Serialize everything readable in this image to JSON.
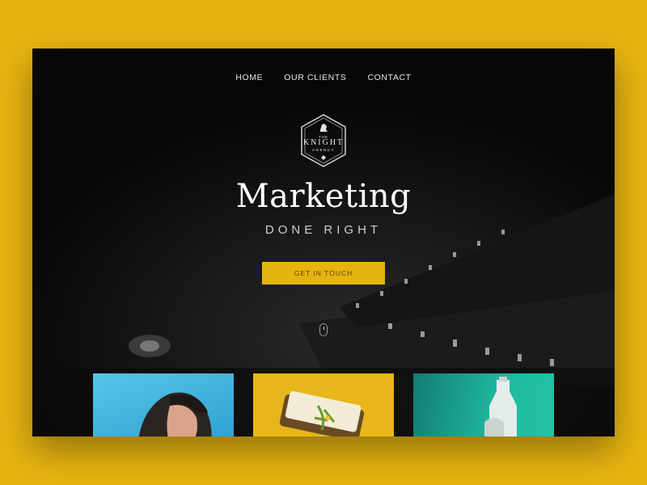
{
  "nav": {
    "items": [
      {
        "label": "HOME"
      },
      {
        "label": "OUR CLIENTS"
      },
      {
        "label": "CONTACT"
      }
    ]
  },
  "logo": {
    "the": "THE",
    "name": "KNIGHT",
    "sub": "AGENCY"
  },
  "hero": {
    "headline": "Marketing",
    "subheadline": "DONE RIGHT",
    "cta_label": "GET IN TOUCH"
  },
  "cards": [
    {
      "subject": "woman portrait"
    },
    {
      "subject": "toast with spread"
    },
    {
      "subject": "glass bottle"
    }
  ],
  "colors": {
    "accent": "#e6b411",
    "background": "#070707"
  }
}
